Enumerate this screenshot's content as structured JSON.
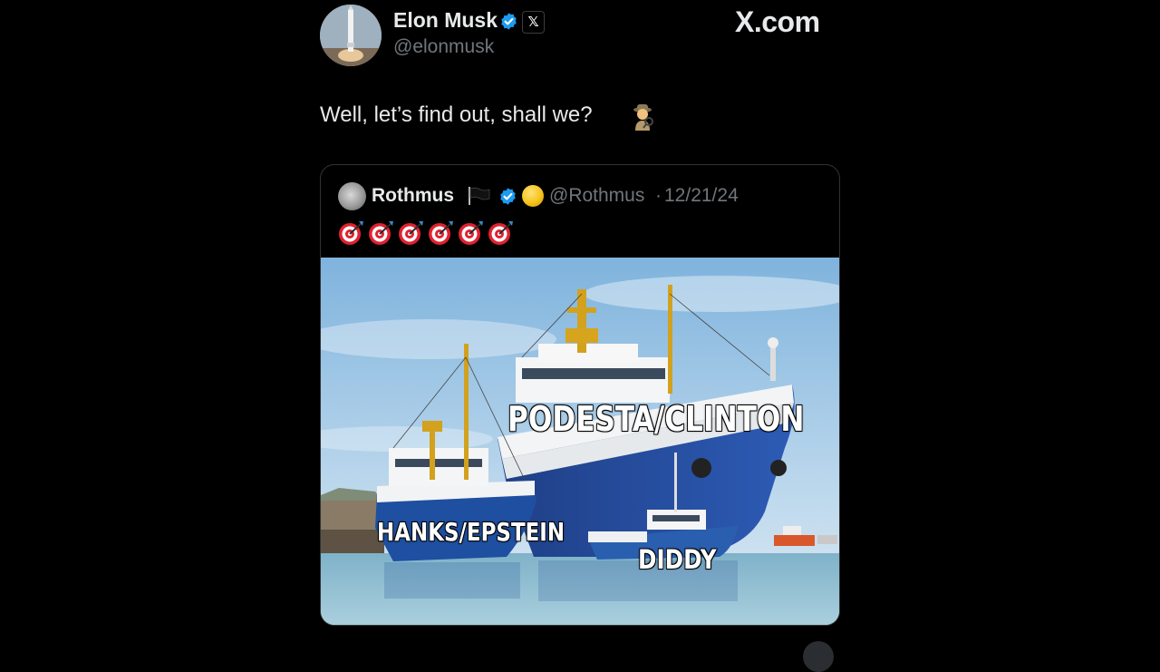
{
  "watermark": "X.com",
  "author": {
    "display_name": "Elon Musk",
    "handle": "@elonmusk",
    "affiliation_badge": "𝕏",
    "verified_color": "#1d9bf0"
  },
  "post": {
    "text": "Well, let’s find out, shall we?",
    "emoji": "detective-icon"
  },
  "quoted_post": {
    "display_name": "Rothmus",
    "flag_emoji": "black-flag-icon",
    "badge_emoji": "yellow-circle-icon",
    "handle": "@Rothmus",
    "separator": "·",
    "date": "12/21/24",
    "target_emoji_count": 6,
    "image": {
      "description_icon": "ships-meme-image",
      "labels": {
        "large_ship": "PODESTA/CLINTON",
        "medium_ship": "HANKS/EPSTEIN",
        "small_boat": "DIDDY"
      }
    }
  },
  "colors": {
    "background": "#000000",
    "text_primary": "#e7e9ea",
    "text_secondary": "#71767b",
    "border": "#2f3336",
    "verified_blue": "#1d9bf0"
  }
}
